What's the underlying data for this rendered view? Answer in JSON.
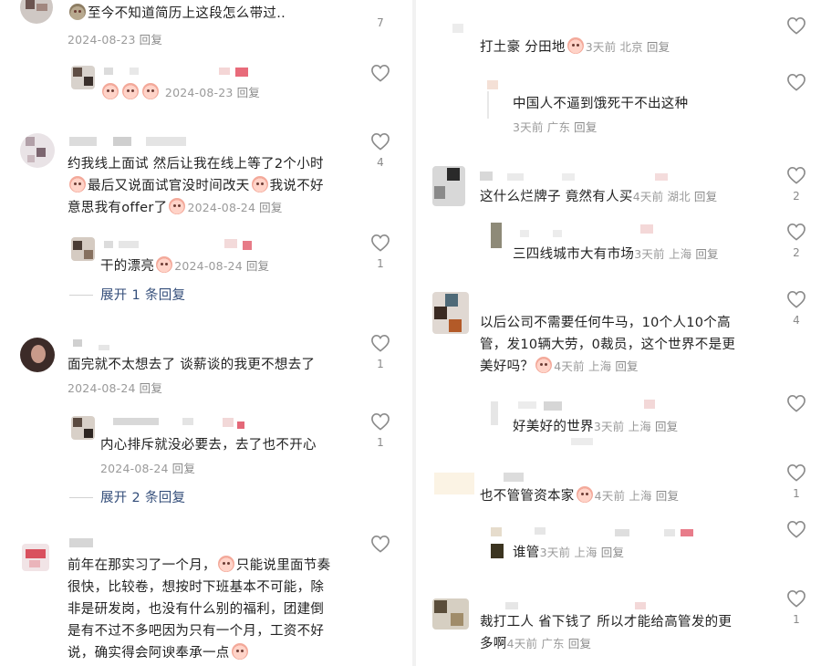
{
  "left": {
    "comments": [
      {
        "text": "至今不知道简历上这段怎么带过..",
        "date": "2024-08-23",
        "reply": "回复",
        "likes": "7"
      },
      {
        "text": "",
        "date": "2024-08-23",
        "reply": "回复",
        "likes": ""
      },
      {
        "text_lines": [
          "约我线上面试 然后让我在线上等了2个小时",
          "最后又说面试官没时间改天",
          "我说不好",
          "意思我有offer了"
        ],
        "date": "2024-08-24",
        "reply": "回复",
        "likes": "4"
      },
      {
        "text": "干的漂亮",
        "date": "2024-08-24",
        "reply": "回复",
        "likes": "1"
      },
      {
        "text": "面完就不太想去了 谈薪谈的我更不想去了",
        "date": "2024-08-24",
        "reply": "回复",
        "likes": "1"
      },
      {
        "text": "内心排斥就没必要去，去了也不开心",
        "date": "2024-08-24",
        "reply": "回复",
        "likes": "1"
      },
      {
        "text_lines": [
          "前年在那实习了一个月，",
          "只能说里面节奏",
          "很快，比较卷，想按时下班基本不可能，除",
          "非是研发岗，也没有什么别的福利，团建倒",
          "是有不过不多吧因为只有一个月，工资不好",
          "说，确实得会阿谀奉承一点"
        ],
        "likes": ""
      }
    ],
    "expand1": "展开 1 条回复",
    "expand2": "展开 2 条回复"
  },
  "right": {
    "comments": [
      {
        "text": "打土豪 分田地",
        "time": "3天前",
        "loc": "北京",
        "reply": "回复",
        "likes": ""
      },
      {
        "text": "中国人不逼到饿死干不出这种",
        "time": "3天前",
        "loc": "广东",
        "reply": "回复",
        "likes": ""
      },
      {
        "text": "这什么烂牌子 竟然有人买",
        "time": "4天前",
        "loc": "湖北",
        "reply": "回复",
        "likes": "2"
      },
      {
        "text": "三四线城市大有市场",
        "time": "3天前",
        "loc": "上海",
        "reply": "回复",
        "likes": "2"
      },
      {
        "text_lines": [
          "以后公司不需要任何牛马，10个人10个高",
          "管，发10辆大劳，0裁员，这个世界不是更",
          "美好吗？"
        ],
        "time": "4天前",
        "loc": "上海",
        "reply": "回复",
        "likes": "4"
      },
      {
        "text": "好美好的世界",
        "time": "3天前",
        "loc": "上海",
        "reply": "回复",
        "likes": ""
      },
      {
        "text": "也不管管资本家",
        "time": "4天前",
        "loc": "上海",
        "reply": "回复",
        "likes": "1"
      },
      {
        "text": "谁管",
        "time": "3天前",
        "loc": "上海",
        "reply": "回复",
        "likes": ""
      },
      {
        "text_lines": [
          "裁打工人 省下钱了 所以才能给高管发的更",
          "多啊"
        ],
        "time": "4天前",
        "loc": "广东",
        "reply": "回复",
        "likes": "1"
      }
    ]
  },
  "colors": {
    "text": "#222222",
    "meta": "#9a9a9a",
    "link": "#344e7a",
    "heart": "#8a8a8a"
  },
  "icons": {
    "like": "heart-outline-icon",
    "emoji": "face-emoji-icon",
    "poop": "poop-emoji-icon"
  }
}
